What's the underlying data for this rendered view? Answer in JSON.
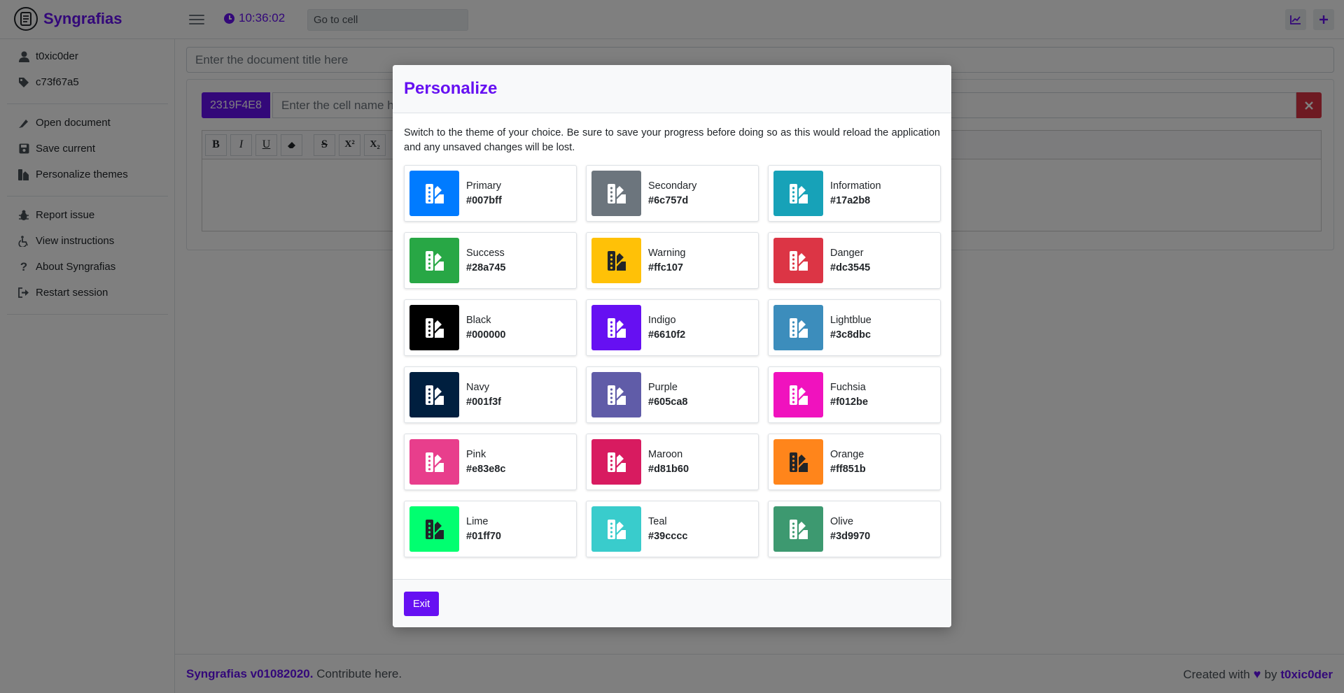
{
  "app": {
    "name": "Syngrafias",
    "time": "10:36:02"
  },
  "topbar": {
    "goto_placeholder": "Go to cell"
  },
  "sidebar": {
    "user": "t0xic0der",
    "session_id": "c73f67a5",
    "items": [
      {
        "label": "Open document",
        "icon": "signature-icon"
      },
      {
        "label": "Save current",
        "icon": "save-icon"
      },
      {
        "label": "Personalize themes",
        "icon": "swatchbook-icon"
      },
      {
        "label": "Report issue",
        "icon": "bug-icon"
      },
      {
        "label": "View instructions",
        "icon": "wheelchair-icon"
      },
      {
        "label": "About Syngrafias",
        "icon": "question-icon"
      },
      {
        "label": "Restart session",
        "icon": "sign-out-icon"
      }
    ]
  },
  "document": {
    "title_placeholder": "Enter the document title here",
    "cell_id": "2319F4E8",
    "cell_name_placeholder": "Enter the cell name here",
    "toolbar": [
      "B",
      "I",
      "U",
      "eraser",
      "S",
      "X²",
      "X₂"
    ]
  },
  "footer": {
    "version": "Syngrafias v01082020.",
    "contribute": "Contribute here.",
    "created_with": "Created with",
    "by": "by",
    "author": "t0xic0der"
  },
  "modal": {
    "title": "Personalize",
    "description": "Switch to the theme of your choice. Be sure to save your progress before doing so as this would reload the application and any unsaved changes will be lost.",
    "exit_label": "Exit",
    "themes": [
      {
        "name": "Primary",
        "hex": "#007bff",
        "icon_color": "#ffffff"
      },
      {
        "name": "Secondary",
        "hex": "#6c757d",
        "icon_color": "#ffffff"
      },
      {
        "name": "Information",
        "hex": "#17a2b8",
        "icon_color": "#ffffff"
      },
      {
        "name": "Success",
        "hex": "#28a745",
        "icon_color": "#ffffff"
      },
      {
        "name": "Warning",
        "hex": "#ffc107",
        "icon_color": "#212529"
      },
      {
        "name": "Danger",
        "hex": "#dc3545",
        "icon_color": "#ffffff"
      },
      {
        "name": "Black",
        "hex": "#000000",
        "icon_color": "#ffffff"
      },
      {
        "name": "Indigo",
        "hex": "#6610f2",
        "icon_color": "#ffffff"
      },
      {
        "name": "Lightblue",
        "hex": "#3c8dbc",
        "icon_color": "#ffffff"
      },
      {
        "name": "Navy",
        "hex": "#001f3f",
        "icon_color": "#ffffff"
      },
      {
        "name": "Purple",
        "hex": "#605ca8",
        "icon_color": "#ffffff"
      },
      {
        "name": "Fuchsia",
        "hex": "#f012be",
        "icon_color": "#ffffff"
      },
      {
        "name": "Pink",
        "hex": "#e83e8c",
        "icon_color": "#ffffff"
      },
      {
        "name": "Maroon",
        "hex": "#d81b60",
        "icon_color": "#ffffff"
      },
      {
        "name": "Orange",
        "hex": "#ff851b",
        "icon_color": "#212529"
      },
      {
        "name": "Lime",
        "hex": "#01ff70",
        "icon_color": "#212529"
      },
      {
        "name": "Teal",
        "hex": "#39cccc",
        "icon_color": "#ffffff"
      },
      {
        "name": "Olive",
        "hex": "#3d9970",
        "icon_color": "#ffffff"
      }
    ]
  }
}
